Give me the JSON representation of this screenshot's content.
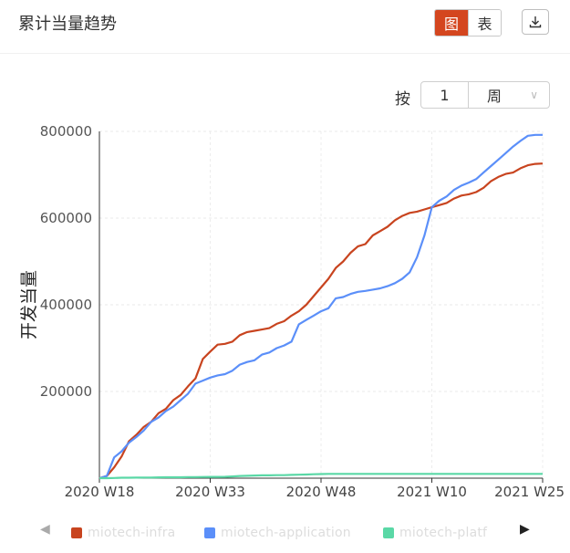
{
  "header": {
    "title": "累计当量趋势",
    "view_chart_label": "图",
    "view_table_label": "表",
    "download_icon": "download-icon"
  },
  "grouping": {
    "label": "按",
    "value": "1",
    "unit": "周"
  },
  "colors": {
    "accent": "#d4461f",
    "series_infra": "#c8441f",
    "series_app": "#5b8ff9",
    "series_platf": "#5ad8a6"
  },
  "legend": {
    "prev_icon": "left-triangle-icon",
    "next_icon": "right-triangle-icon",
    "items": [
      {
        "label": "miotech-infra",
        "color": "#c8441f"
      },
      {
        "label": "miotech-application",
        "color": "#5b8ff9"
      },
      {
        "label": "miotech-platf",
        "color": "#5ad8a6"
      }
    ]
  },
  "chart_data": {
    "type": "line",
    "ylabel": "开发当量",
    "xlabel": "",
    "ylim": [
      0,
      800000
    ],
    "y_ticks": [
      "800000",
      "600000",
      "400000",
      "200000"
    ],
    "x_ticks": [
      "2020 W18",
      "2020 W33",
      "2020 W48",
      "2021 W10",
      "2021 W25"
    ],
    "x": [
      1,
      2,
      3,
      4,
      5,
      6,
      7,
      8,
      9,
      10,
      11,
      12,
      13,
      14,
      15,
      16,
      17,
      18,
      19,
      20,
      21,
      22,
      23,
      24,
      25,
      26,
      27,
      28,
      29,
      30,
      31,
      32,
      33,
      34,
      35,
      36,
      37,
      38,
      39,
      40,
      41,
      42,
      43,
      44,
      45,
      46,
      47,
      48,
      49,
      50,
      51,
      52,
      53,
      54,
      55,
      56,
      57,
      58,
      59,
      60,
      61
    ],
    "x_tick_index": [
      1,
      16,
      31,
      46,
      61
    ],
    "series": [
      {
        "name": "miotech-infra",
        "values": [
          0,
          5000,
          25000,
          50000,
          85000,
          100000,
          118000,
          130000,
          150000,
          160000,
          180000,
          192000,
          212000,
          230000,
          275000,
          292000,
          308000,
          310000,
          315000,
          330000,
          337000,
          340000,
          343000,
          346000,
          356000,
          362000,
          375000,
          385000,
          400000,
          420000,
          440000,
          460000,
          485000,
          500000,
          520000,
          535000,
          540000,
          560000,
          570000,
          580000,
          595000,
          605000,
          612000,
          615000,
          620000,
          625000,
          630000,
          635000,
          645000,
          652000,
          655000,
          660000,
          670000,
          685000,
          695000,
          702000,
          705000,
          715000,
          722000,
          725000,
          726000
        ]
      },
      {
        "name": "miotech-application",
        "values": [
          0,
          5000,
          48000,
          62000,
          82000,
          95000,
          110000,
          130000,
          140000,
          155000,
          165000,
          180000,
          195000,
          218000,
          225000,
          232000,
          237000,
          240000,
          248000,
          262000,
          268000,
          272000,
          285000,
          290000,
          300000,
          306000,
          315000,
          355000,
          365000,
          375000,
          385000,
          392000,
          415000,
          418000,
          425000,
          430000,
          432000,
          435000,
          438000,
          443000,
          450000,
          460000,
          475000,
          510000,
          560000,
          625000,
          640000,
          650000,
          665000,
          675000,
          682000,
          690000,
          705000,
          720000,
          735000,
          750000,
          765000,
          778000,
          790000,
          792000,
          792000
        ]
      },
      {
        "name": "miotech-platf",
        "values": [
          0,
          0,
          500,
          1000,
          1000,
          1200,
          1500,
          1500,
          1800,
          2000,
          2000,
          2200,
          2500,
          2500,
          2800,
          3000,
          3000,
          3200,
          4000,
          5000,
          5500,
          6000,
          6500,
          6500,
          7000,
          7000,
          7500,
          8000,
          8500,
          9000,
          9500,
          10000,
          10000,
          10000,
          10000,
          10000,
          10000,
          10000,
          10000,
          10000,
          10000,
          10000,
          10000,
          10000,
          10000,
          10000,
          10000,
          10000,
          10000,
          10000,
          10000,
          10000,
          10000,
          10000,
          10000,
          10000,
          10000,
          10000,
          10000,
          10000,
          10000
        ]
      }
    ],
    "grid": true
  }
}
